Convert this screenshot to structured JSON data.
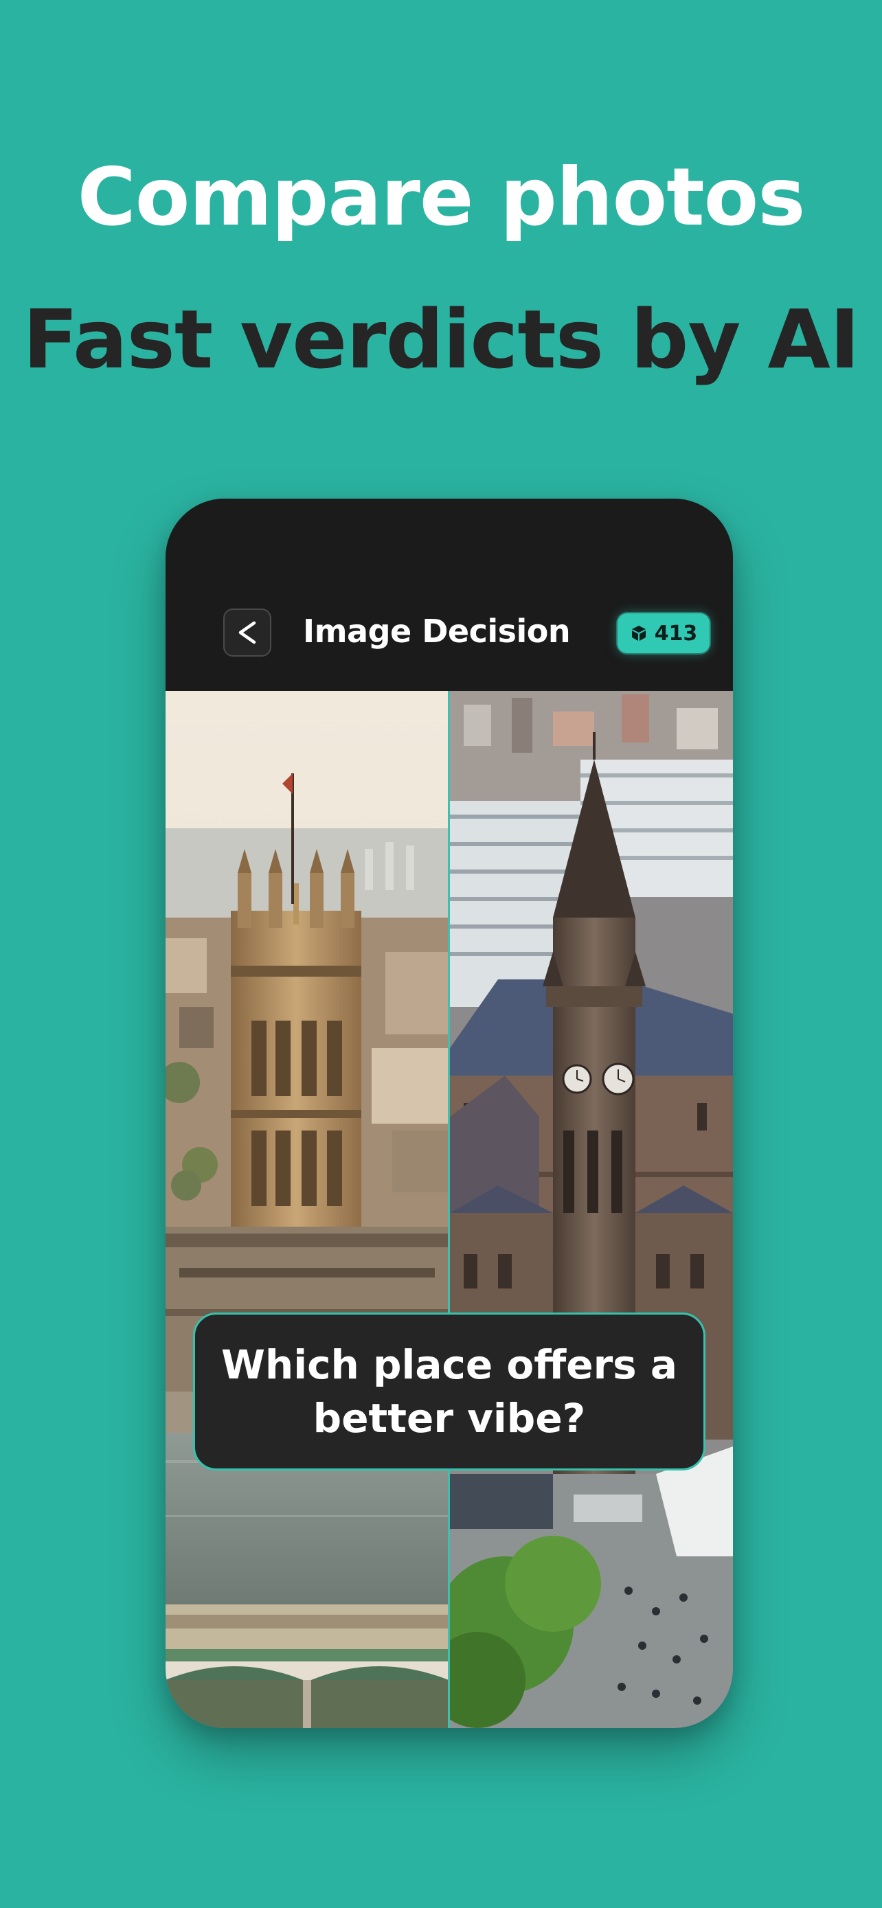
{
  "headline": {
    "line1": "Compare photos",
    "line2": "Fast verdicts by AI"
  },
  "app": {
    "title": "Image Decision",
    "back_label": "<",
    "credits": "413",
    "credit_icon": "cube-icon"
  },
  "photos": {
    "left": {
      "subject": "London Westminster tower",
      "icon": "photo-left"
    },
    "right": {
      "subject": "Manchester town hall clock tower",
      "icon": "photo-right"
    }
  },
  "question": "Which place offers a better vibe?",
  "colors": {
    "background": "#2bb3a1",
    "accent": "#30c9b4",
    "phone": "#1b1b1b",
    "card": "#252525"
  }
}
